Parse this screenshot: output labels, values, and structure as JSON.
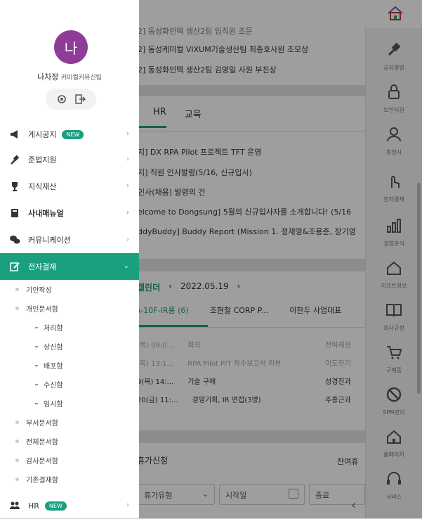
{
  "background": {
    "notices_top": [
      "2] 동성화인텍 생산2팀 임직원 조문",
      "2] 동성케미컬 VIXUM기술생산팀 최종호사원 조모상",
      "2] 동성화인텍 생산2팀 김영일 사원 부친상"
    ],
    "tabs": [
      "HR",
      "교육"
    ],
    "hr_items": [
      "지] DX RPA Pilot 프로젝트 TFT 운영",
      "지] 직원 인사발령(5/16, 신규입사)",
      "인사(채용) 발령의 건",
      "elcome to Dongsung] 5월의 신규입사자를 소개합니다! (5/16",
      "ddyBuddy] Buddy Report (Mission 1. 정재영&조용준, 장기영"
    ],
    "calendar": {
      "title": "캘린더",
      "date": "2022.05.19",
      "tabs": [
        "iA-10F-IR룸 (6)",
        "조현철 CORP P...",
        "이한두 사업대표"
      ],
      "rows": [
        {
          "time": "(목) 09:0...",
          "text": "회의",
          "right": "전략재관"
        },
        {
          "time": "(목) 13:1...",
          "text": "RPA Pilot P/T 착수보고서 리뷰",
          "right": "이도헌기"
        },
        {
          "time": "9(목) 14:...",
          "text": "기술 구매",
          "right": "성경진과"
        },
        {
          "time": "20(금) 11:...",
          "text": "경영기획, IR 면접(3명)",
          "right": "주홍근과"
        }
      ]
    },
    "vacation": {
      "title": "휴가신청",
      "right": "잔여휴",
      "type_placeholder": "휴가유형",
      "start_placeholder": "시작일",
      "end_placeholder": "종료"
    }
  },
  "rail": [
    {
      "label": "공지명령",
      "icon": "gavel-icon"
    },
    {
      "label": "보안지원",
      "icon": "lock-icon"
    },
    {
      "label": "총정시",
      "icon": "person-icon"
    },
    {
      "label": "전자결재",
      "icon": "hand-pointer-icon"
    },
    {
      "label": "경영분석",
      "icon": "bar-chart-icon"
    },
    {
      "label": "지프트정보",
      "icon": "home-outline-icon"
    },
    {
      "label": "회사규정",
      "icon": "book-icon"
    },
    {
      "label": "구매품",
      "icon": "cart-icon"
    },
    {
      "label": "SPM관리",
      "icon": "ban-icon"
    },
    {
      "label": "홈페이지",
      "icon": "home-icon"
    },
    {
      "label": "서비스",
      "icon": "headset-icon"
    }
  ],
  "user": {
    "avatar_initial": "나",
    "name": "나차장",
    "dept": "커미컬커뮤신팀"
  },
  "menu": [
    {
      "label": "게시공지",
      "icon": "megaphone-icon",
      "badge": "NEW"
    },
    {
      "label": "준법지원",
      "icon": "gavel-icon",
      "badge": ""
    },
    {
      "label": "지식재산",
      "icon": "trophy-icon",
      "badge": ""
    },
    {
      "label": "사내매뉴얼",
      "icon": "manual-icon",
      "badge": ""
    },
    {
      "label": "커뮤니케이션",
      "icon": "chat-icon",
      "badge": ""
    },
    {
      "label": "전자결재",
      "icon": "edit-icon",
      "badge": ""
    }
  ],
  "approval_sub": [
    {
      "label": "기안작성",
      "level": 1
    },
    {
      "label": "개인문서함",
      "level": 1
    },
    {
      "label": "처리함",
      "level": 2
    },
    {
      "label": "상신함",
      "level": 2
    },
    {
      "label": "배포함",
      "level": 2
    },
    {
      "label": "수신함",
      "level": 2
    },
    {
      "label": "임시함",
      "level": 2
    },
    {
      "label": "부서문서함",
      "level": 1
    },
    {
      "label": "전체문서함",
      "level": 1
    },
    {
      "label": "감사문서함",
      "level": 1
    },
    {
      "label": "기존결재함",
      "level": 1
    }
  ],
  "hr_menu": {
    "label": "HR",
    "badge": "NEW"
  },
  "colors": {
    "accent": "#1a9f7f",
    "avatar": "#8e3c97"
  }
}
